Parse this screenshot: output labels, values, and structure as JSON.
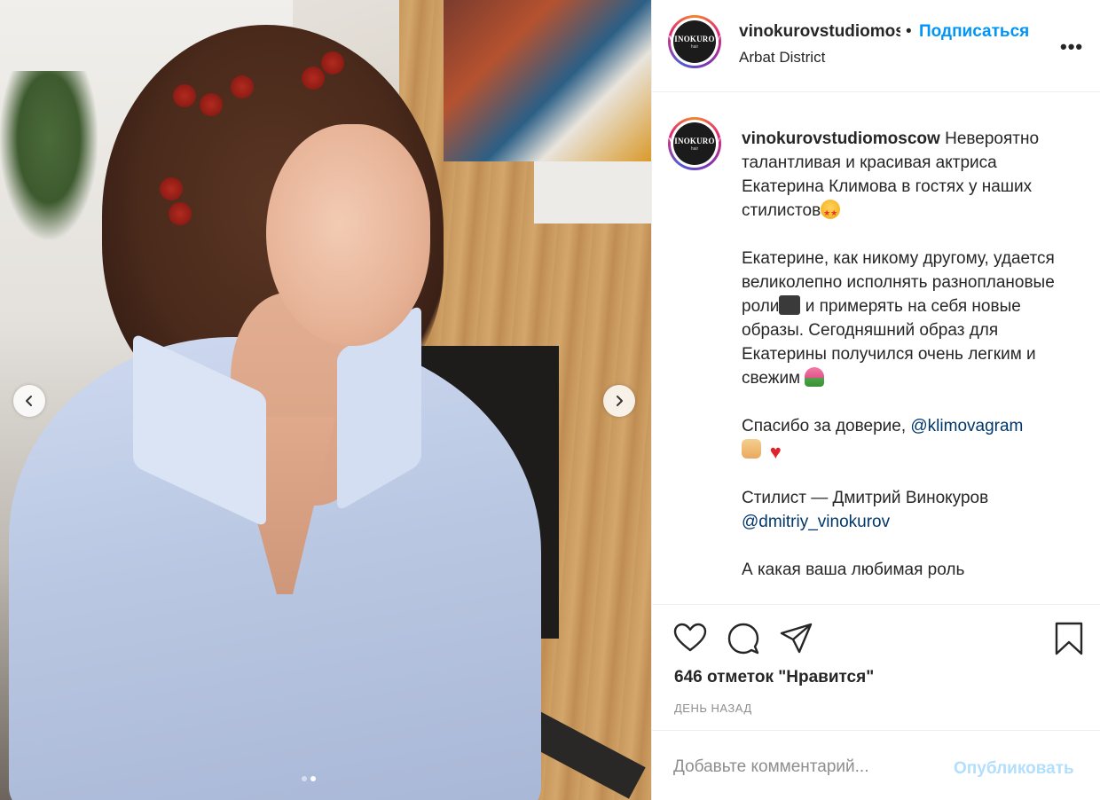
{
  "photo": {
    "carousel_prev_icon": "chevron-left-icon",
    "carousel_next_icon": "chevron-right-icon",
    "dots_count": 2,
    "active_dot": 1
  },
  "header": {
    "username": "vinokurovstudiomoscow",
    "dot": "•",
    "follow_label": "Подписаться",
    "location": "Arbat District",
    "more_label": "•••",
    "avatar_text": "VINOKUROV",
    "avatar_subtext": "hair"
  },
  "caption": {
    "username": "vinokurovstudiomoscow",
    "p1": "Невероятно талантливая и красивая актриса Екатерина Климова в гостях у наших стилистов",
    "p2a": "Екатерине, как никому другому, удается великолепно исполнять разноплановые роли",
    "p2b": " и примерять на себя новые образы. Сегодняшний образ для Екатерины получился очень легким и свежим",
    "p3": "Спасибо за доверие, ",
    "p3_mention": "@klimovagram",
    "p4": "Стилист — Дмитрий Винокуров",
    "p4_mention": "@dmitriy_vinokurov",
    "p5": "А какая ваша любимая роль"
  },
  "actions": {
    "like_icon": "heart-icon",
    "comment_icon": "comment-icon",
    "share_icon": "send-icon",
    "save_icon": "bookmark-icon",
    "likes": "646 отметок \"Нравится\"",
    "date": "День назад"
  },
  "comment": {
    "placeholder": "Добавьте комментарий...",
    "publish_label": "Опубликовать"
  },
  "colors": {
    "accent": "#0095f6",
    "publish_disabled": "#b2dffc",
    "text": "#262626",
    "muted": "#8e8e8e"
  }
}
